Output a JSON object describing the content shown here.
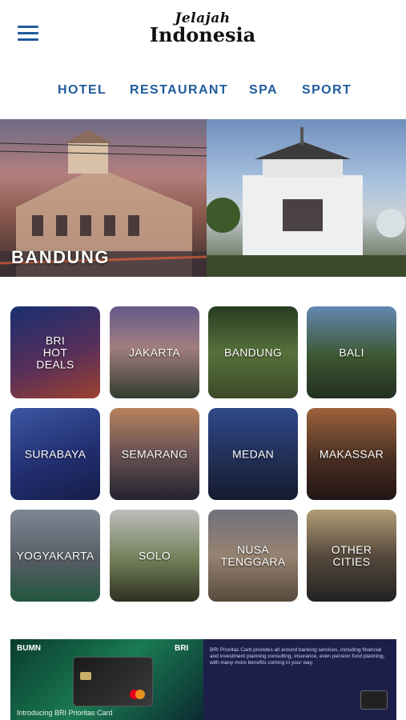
{
  "app": {
    "logo_script": "Jelajah",
    "logo_main": "Indonesia",
    "menu_icon": "hamburger-menu-icon",
    "accent_color": "#1f5b9c"
  },
  "nav": {
    "items": [
      {
        "label": "HOTEL"
      },
      {
        "label": "RESTAURANT"
      },
      {
        "label": "SPA"
      },
      {
        "label": "SPORT"
      }
    ]
  },
  "banner": {
    "title": "BANDUNG"
  },
  "cities": {
    "tiles": [
      {
        "label": "BRI\nHOT\nDEALS"
      },
      {
        "label": "JAKARTA"
      },
      {
        "label": "BANDUNG"
      },
      {
        "label": "BALI"
      },
      {
        "label": "SURABAYA"
      },
      {
        "label": "SEMARANG"
      },
      {
        "label": "MEDAN"
      },
      {
        "label": "MAKASSAR"
      },
      {
        "label": "YOGYAKARTA"
      },
      {
        "label": "SOLO"
      },
      {
        "label": "NUSA\nTENGGARA"
      },
      {
        "label": "OTHER\nCITIES"
      }
    ]
  },
  "promo": {
    "bumn_logo": "BUMN",
    "bri_logo": "BRI",
    "caption": "Introducing BRI Prioritas Card",
    "description": "BRI Prioritas Card provides all around banking services, including financial and investment planning consulting, insurance, even pension fund planning, with many more benefits coming in your way."
  }
}
